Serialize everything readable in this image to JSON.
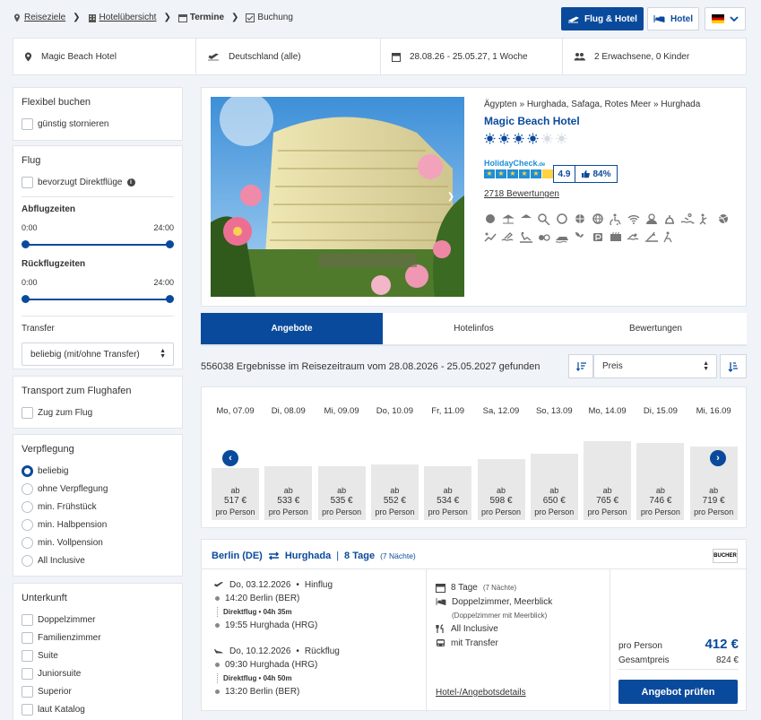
{
  "breadcrumbs": [
    {
      "label": "Reiseziele",
      "icon": "location-pin-icon"
    },
    {
      "label": "Hotelübersicht",
      "icon": "building-icon"
    },
    {
      "label": "Termine",
      "icon": "calendar-icon"
    },
    {
      "label": "Buchung",
      "icon": "checkbox-icon"
    }
  ],
  "header": {
    "flight_hotel_label": "Flug & Hotel",
    "hotel_label": "Hotel",
    "language": "DE"
  },
  "search": {
    "hotel": "Magic Beach Hotel",
    "departure": "Deutschland (alle)",
    "dates": "28.08.26 - 25.05.27, 1 Woche",
    "travellers": "2 Erwachsene, 0 Kinder"
  },
  "filters": {
    "flexible": {
      "title": "Flexibel buchen",
      "cancel": "günstig stornieren"
    },
    "flight": {
      "title": "Flug",
      "direct": "bevorzugt Direktflüge",
      "departure_title": "Abflugzeiten",
      "return_title": "Rückflugzeiten",
      "time_from": "0:00",
      "time_to": "24:00",
      "transfer_title": "Transfer",
      "transfer_value": "beliebig (mit/ohne Transfer)"
    },
    "transport": {
      "title": "Transport zum Flughafen",
      "train": "Zug zum Flug"
    },
    "board": {
      "title": "Verpflegung",
      "options": [
        "beliebig",
        "ohne Verpflegung",
        "min. Frühstück",
        "min. Halbpension",
        "min. Vollpension",
        "All Inclusive"
      ],
      "selected": 0
    },
    "room": {
      "title": "Unterkunft",
      "options": [
        "Doppelzimmer",
        "Familienzimmer",
        "Suite",
        "Juniorsuite",
        "Superior",
        "laut Katalog"
      ]
    }
  },
  "hotel": {
    "region": "Ägypten » Hurghada, Safaga, Rotes Meer » Hurghada",
    "name": "Magic Beach Hotel",
    "suns_filled": 4,
    "suns_total": 6,
    "hc_logo_text": "HolidayCheck",
    "hc_logo_suffix": ".de",
    "score": "4.9",
    "recommend": "84%",
    "reviews": "2718 Bewertungen",
    "amenity_icons": [
      "spa-icon",
      "beach-icon",
      "beach-umbrella-icon",
      "tennis-icon",
      "aqua-icon",
      "ball-icon",
      "globe-icon",
      "wheelchair-icon",
      "wifi-icon",
      "mini-club-icon",
      "gastro-icon",
      "swim-icon",
      "fitness-icon",
      "volleyball-icon",
      "massage-icon",
      "surf-icon",
      "diving-icon",
      "billiards-icon",
      "jetski-icon",
      "garden-icon",
      "parking-icon",
      "sauna-icon",
      "swimming-icon",
      "waterski-icon",
      "animation-icon"
    ]
  },
  "tabs": [
    "Angebote",
    "Hotelinfos",
    "Bewertungen"
  ],
  "results": {
    "count_text": "556038 Ergebnisse im Reisezeitraum vom 28.08.2026 - 25.05.2027 gefunden",
    "sort_value": "Preis"
  },
  "calendar": {
    "days": [
      {
        "date": "Mo, 07.09",
        "price": "517 €"
      },
      {
        "date": "Di, 08.09",
        "price": "533 €"
      },
      {
        "date": "Mi, 09.09",
        "price": "535 €"
      },
      {
        "date": "Do, 10.09",
        "price": "552 €"
      },
      {
        "date": "Fr, 11.09",
        "price": "534 €"
      },
      {
        "date": "Sa, 12.09",
        "price": "598 €"
      },
      {
        "date": "So, 13.09",
        "price": "650 €"
      },
      {
        "date": "Mo, 14.09",
        "price": "765 €"
      },
      {
        "date": "Di, 15.09",
        "price": "746 €"
      },
      {
        "date": "Mi, 16.09",
        "price": "719 €"
      }
    ],
    "prefix": "ab",
    "suffix": "pro Person"
  },
  "offer": {
    "from": "Berlin (DE)",
    "to": "Hurghada",
    "duration": "8 Tage",
    "nights": "(7 Nächte)",
    "operator": "BUCHER",
    "outbound": {
      "date": "Do, 03.12.2026",
      "type": "Hinflug",
      "dep": "14:20 Berlin (BER)",
      "info": "Direktflug • 04h 35m",
      "arr": "19:55 Hurghada (HRG)"
    },
    "inbound": {
      "date": "Do, 10.12.2026",
      "type": "Rückflug",
      "dep": "09:30 Hurghada (HRG)",
      "info": "Direktflug • 04h 50m",
      "arr": "13:20 Berlin (BER)"
    },
    "stay": "8 Tage",
    "stay_nights": "(7 Nächte)",
    "room": "Doppelzimmer, Meerblick",
    "room_detail": "(Doppelzimmer mit Meerblick)",
    "board": "All Inclusive",
    "transfer": "mit Transfer",
    "details_link": "Hotel-/Angebotsdetails",
    "per_person_label": "pro Person",
    "per_person_price": "412 €",
    "total_label": "Gesamtpreis",
    "total_price": "824 €",
    "cta": "Angebot prüfen"
  },
  "colors": {
    "primary": "#0a4a9c",
    "background": "#f0f3f7"
  }
}
